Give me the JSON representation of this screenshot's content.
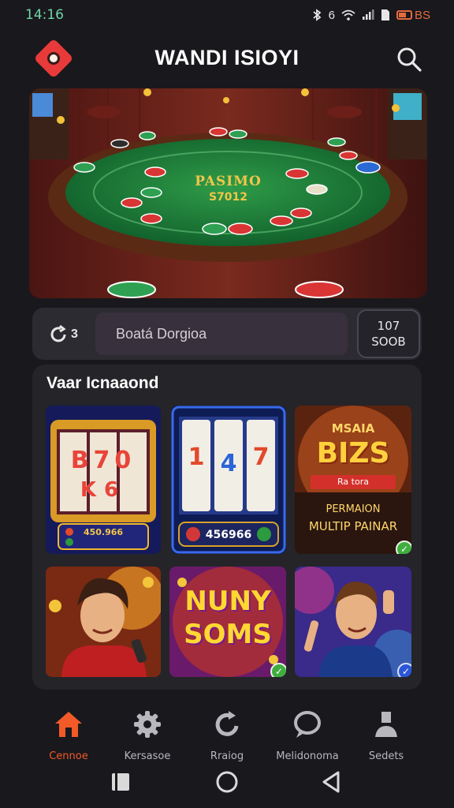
{
  "status_bar": {
    "time": "14:16",
    "icons": [
      "bluetooth-icon",
      "wifi-icon",
      "signal-icon",
      "sim-icon"
    ],
    "network_text": "6",
    "battery_text": "BS"
  },
  "header": {
    "title": "WANDI ISIOYI",
    "logo_icon": "casino-chip-logo",
    "search_icon": "search-icon"
  },
  "hero": {
    "table_title": "PASIMO",
    "table_subtitle": "S7012"
  },
  "search_row": {
    "icon_text": "3",
    "field_value": "Boatá Dorgioa",
    "coins_top": "107",
    "coins_bottom": "SOOB"
  },
  "games": {
    "section_title": "Vaar Icnaaond",
    "tiles": [
      {
        "name": "slot-machine-classic",
        "lines": [
          "B70",
          "K6"
        ],
        "footer": "450.966"
      },
      {
        "name": "slot-machine-blue",
        "reels": [
          "1",
          "4",
          "7"
        ],
        "footer": "456966"
      },
      {
        "name": "mega-bizs",
        "top": "MSAIA",
        "main": "BIZS",
        "ribbon": "Ra tora",
        "sub1": "PERMAION",
        "sub2": "MULTIP PAINAR",
        "verified": true
      },
      {
        "name": "singer-game",
        "verified": false
      },
      {
        "name": "nuny-soms",
        "line1": "NUNY",
        "line2": "SOMS",
        "verified": true
      },
      {
        "name": "hero-game",
        "verified": true
      }
    ]
  },
  "nav": {
    "items": [
      {
        "label": "Cennoe",
        "icon": "home-icon",
        "active": true
      },
      {
        "label": "Kersasoe",
        "icon": "gear-icon",
        "active": false
      },
      {
        "label": "Rraiog",
        "icon": "refresh-icon",
        "active": false
      },
      {
        "label": "Melidonoma",
        "icon": "chat-icon",
        "active": false
      },
      {
        "label": "Sedets",
        "icon": "profile-icon",
        "active": false
      }
    ]
  },
  "colors": {
    "accent": "#f25a28",
    "background": "#19181d",
    "panel": "#252429"
  }
}
